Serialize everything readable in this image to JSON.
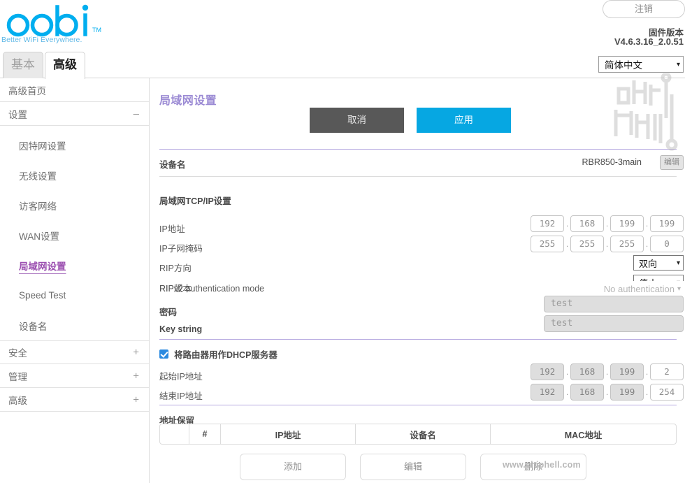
{
  "header": {
    "brand": "orbi",
    "brand_tm": "TM",
    "tagline": "Better WiFi Everywhere.",
    "logout_label": "注销",
    "firmware_label": "固件版本",
    "firmware_version": "V4.6.3.16_2.0.51",
    "brand_color": "#00aeef"
  },
  "tabs": {
    "basic": "基本",
    "advanced": "高级",
    "language_selected": "简体中文"
  },
  "sidebar": {
    "items": [
      {
        "label": "高级首页",
        "type": "top",
        "toggle": ""
      },
      {
        "label": "设置",
        "type": "top",
        "toggle": "–"
      },
      {
        "label": "因特网设置",
        "type": "sub",
        "selected": false
      },
      {
        "label": "无线设置",
        "type": "sub",
        "selected": false
      },
      {
        "label": "访客网络",
        "type": "sub",
        "selected": false
      },
      {
        "label": "WAN设置",
        "type": "sub",
        "selected": false
      },
      {
        "label": "局域网设置",
        "type": "sub",
        "selected": true
      },
      {
        "label": "Speed Test",
        "type": "sub",
        "selected": false
      },
      {
        "label": "设备名",
        "type": "sub",
        "selected": false
      },
      {
        "label": "安全",
        "type": "top",
        "toggle": "+"
      },
      {
        "label": "管理",
        "type": "top",
        "toggle": "+"
      },
      {
        "label": "高级",
        "type": "top",
        "toggle": "+"
      }
    ]
  },
  "main": {
    "page_title": "局域网设置",
    "cancel_label": "取消",
    "apply_label": "应用",
    "device_name_label": "设备名",
    "device_name_value": "RBR850-3main",
    "edit_label": "编辑",
    "tcpip_section": "局域网TCP/IP设置",
    "ip_address_label": "IP地址",
    "ip_address": [
      "192",
      "168",
      "199",
      "199"
    ],
    "subnet_label": "IP子网掩码",
    "subnet": [
      "255",
      "255",
      "255",
      "0"
    ],
    "rip_direction_label": "RIP方向",
    "rip_direction_value": "双向",
    "rip_version_label": "RIP版本",
    "rip_version_value": "停止",
    "ripv2_auth_label": "RIPv2 authentication mode",
    "ripv2_auth_value": "No authentication",
    "password_label": "密码",
    "password_placeholder": "test",
    "key_string_label": "Key string",
    "key_string_placeholder": "test",
    "dhcp_checkbox_label": "将路由器用作DHCP服务器",
    "dhcp_checked": true,
    "dhcp_start_label": "起始IP地址",
    "dhcp_start": [
      "192",
      "168",
      "199",
      "2"
    ],
    "dhcp_end_label": "结束IP地址",
    "dhcp_end": [
      "192",
      "168",
      "199",
      "254"
    ],
    "reservation_section": "地址保留",
    "table_headers": [
      "",
      "#",
      "IP地址",
      "设备名",
      "MAC地址"
    ],
    "add_label": "添加",
    "edit_row_label": "编辑",
    "delete_label": "删除"
  },
  "watermark": {
    "url": "www.chiphell.com",
    "logo_name": "chiphell-logo"
  }
}
